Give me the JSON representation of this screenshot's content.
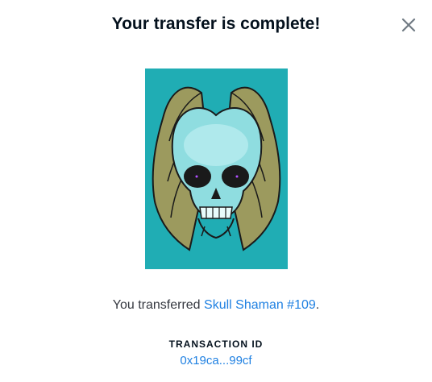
{
  "modal": {
    "title": "Your transfer is complete!",
    "close_icon": "close-icon"
  },
  "nft": {
    "image_icon": "skull-with-bat-wings",
    "background_color": "#20adb4"
  },
  "message": {
    "prefix": "You transferred ",
    "item_name": "Skull Shaman #109",
    "suffix": "."
  },
  "transaction": {
    "label": "TRANSACTION ID",
    "id": "0x19ca...99cf"
  },
  "colors": {
    "link": "#2081e2",
    "text": "#353840",
    "title": "#04111d"
  }
}
